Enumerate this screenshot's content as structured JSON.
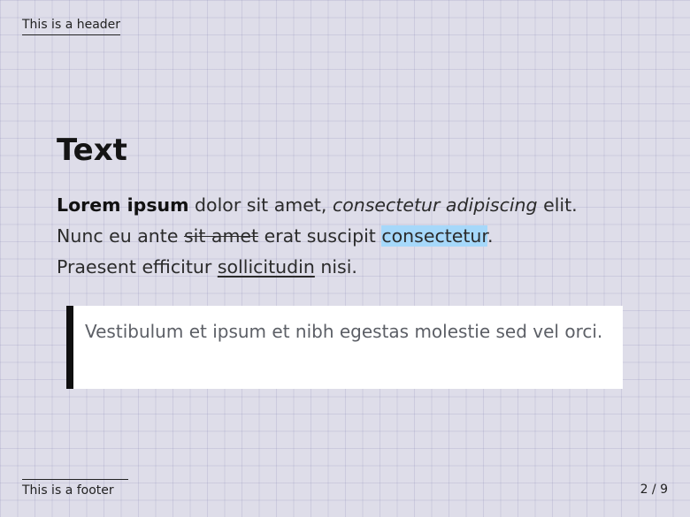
{
  "header": {
    "text": "This is a header"
  },
  "slide": {
    "title": "Text",
    "paragraph": {
      "bold": "Lorem ipsum",
      "text1": " dolor sit amet, ",
      "italic": "consectetur adipiscing",
      "text2": " elit.",
      "text3": "Nunc eu ante ",
      "strike": "sit amet",
      "text4": " erat suscipit ",
      "highlight": "consectetur",
      "text5": ".",
      "text6": "Praesent efficitur ",
      "underline": "sollicitudin",
      "text7": " nisi."
    },
    "quote": "Vestibulum et ipsum et nibh egestas molestie sed vel orci."
  },
  "footer": {
    "text": "This is a footer",
    "page": "2 / 9"
  },
  "colors": {
    "background": "#dedde9",
    "highlight": "#a6d8fa",
    "quote_bar": "#0f0f0f"
  }
}
